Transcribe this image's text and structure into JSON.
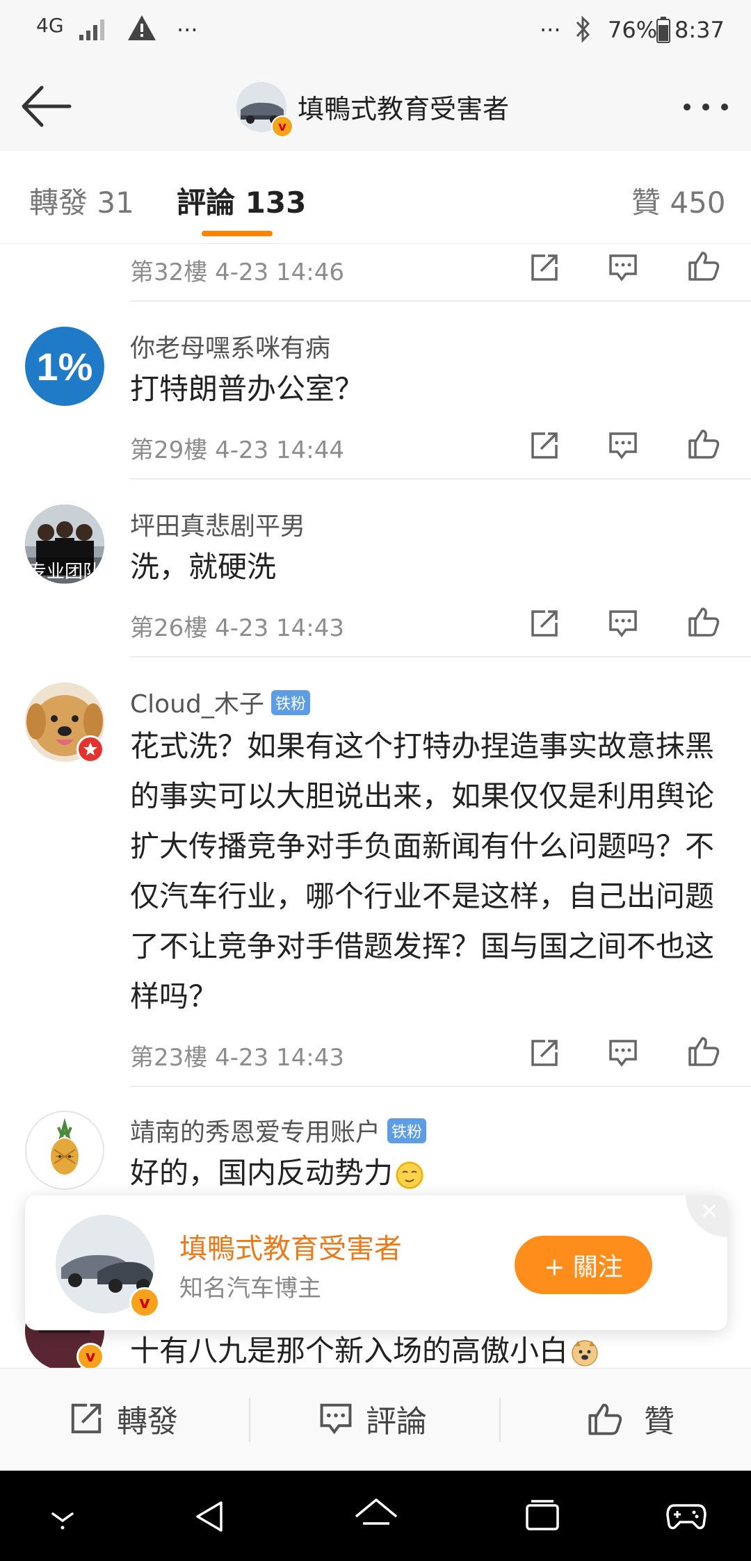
{
  "status_bar": {
    "network": "4G",
    "more_left": "···",
    "more_right": "···",
    "battery": "76%",
    "time": "8:37"
  },
  "nav": {
    "title": "填鴨式教育受害者"
  },
  "tabs": {
    "repost": "轉發 31",
    "comment": "評論 133",
    "like": "贊 450"
  },
  "comments": [
    {
      "floor": "第32樓 4-23 14:46"
    },
    {
      "username": "你老母嘿系咪有病",
      "text": "打特朗普办公室？",
      "floor": "第29樓 4-23 14:44",
      "avatar_text": "1%"
    },
    {
      "username": "坪田真悲剧平男",
      "text": "洗，就硬洗",
      "floor": "第26樓 4-23 14:43",
      "avatar_text": "专业团队"
    },
    {
      "username": "Cloud_木子",
      "badge": "铁粉",
      "text": "花式洗？如果有这个打特办捏造事实故意抹黑的事实可以大胆说出来，如果仅仅是利用舆论扩大传播竞争对手负面新闻有什么问题吗？不仅汽车行业，哪个行业不是这样，自己出问题了不让竞争对手借题发挥？国与国之间不也这样吗？",
      "floor": "第23樓 4-23 14:43"
    },
    {
      "username": "靖南的秀恩爱专用账户",
      "badge": "铁粉",
      "text": "好的，国内反动势力"
    },
    {
      "text": "十有八九是那个新入场的高傲小白"
    }
  ],
  "popup": {
    "name": "填鴨式教育受害者",
    "desc": "知名汽车博主",
    "follow": "+ 關注"
  },
  "bottom_bar": {
    "repost": "轉發",
    "comment": "評論",
    "like": "贊"
  },
  "colors": {
    "accent": "#ff8200",
    "follow_button": "#ff8d1b",
    "badge": "#5c9de5",
    "verified": "#f7a21b"
  }
}
